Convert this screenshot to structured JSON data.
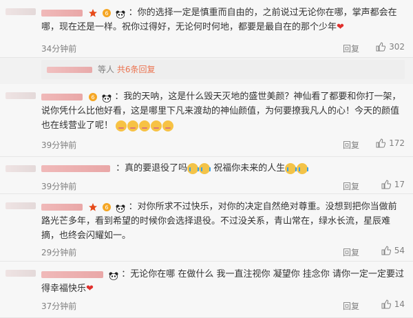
{
  "comments": [
    {
      "text": "：你的选择一定是慎重而自由的，之前说过无论你在哪，掌声都会在哪，现在还是一样。祝你过得好，无论何时何地，都要是最自在的那个少年",
      "time": "34分钟前",
      "reply_label": "回复",
      "likes": "302"
    },
    {
      "text": "：我的天呐，这是什么毁天灭地的盛世美颜？神仙看了都要和你打一架，说你凭什么比他好看，这是哪里下凡来渡劫的神仙颜值，为何要撩我凡人的心！今天的颜值也在线营业了呢！",
      "time": "39分钟前",
      "reply_label": "回复",
      "likes": "172"
    },
    {
      "text": "：真的要退役了吗",
      "text2": "祝福你未来的人生",
      "time": "39分钟前",
      "reply_label": "回复",
      "likes": "17"
    },
    {
      "text": "：对你所求不过快乐，对你的决定自然绝对尊重。没想到把你当做前路光芒多年，看到希望的时候你会选择退役。不过没关系，青山常在，绿水长流，星辰难摘，也终会闪耀如一。",
      "time": "29分钟前",
      "reply_label": "回复",
      "likes": "54"
    },
    {
      "text": "：无论你在哪 在做什么 我一直注视你 凝望你 挂念你 请你一定一定要过得幸福快乐",
      "time": "37分钟前",
      "reply_label": "回复",
      "likes": "14"
    }
  ],
  "replies_summary": {
    "prefix": "等人",
    "link": "共6条回复"
  }
}
